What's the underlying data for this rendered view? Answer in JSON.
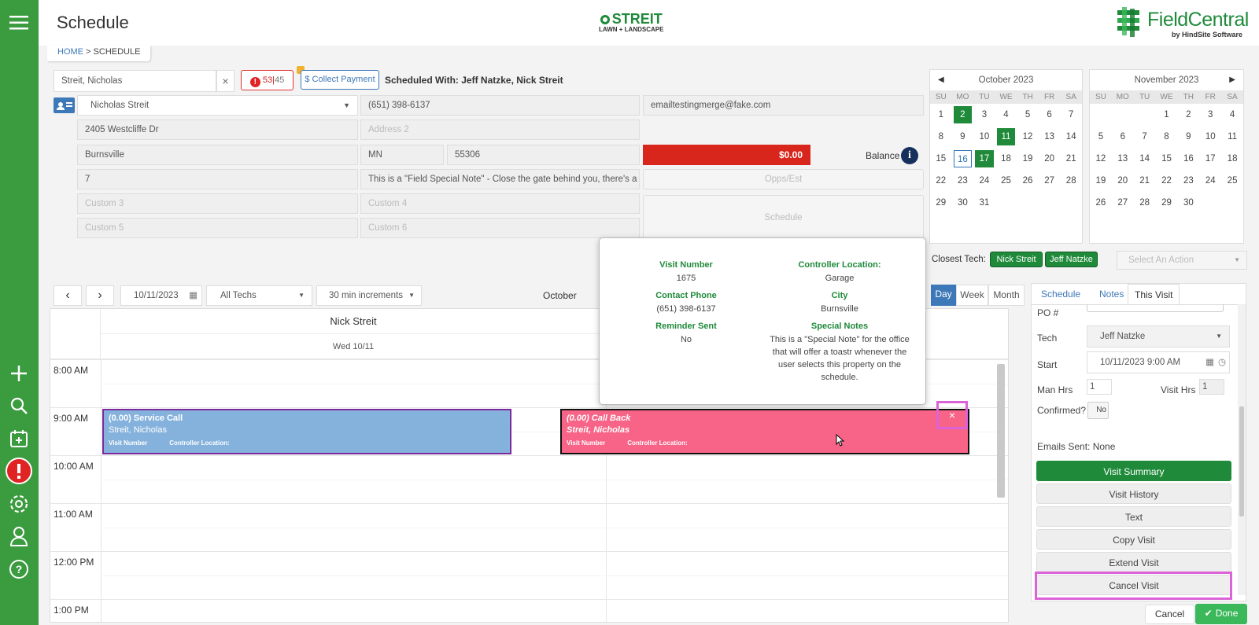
{
  "header": {
    "title": "Schedule",
    "brand_main": "STREIT",
    "brand_sub": "LAWN + LANDSCAPE",
    "logo_main": "FieldCentral",
    "logo_sub": "by HindSite Software"
  },
  "breadcrumb": {
    "home": "HOME",
    "sep": " > ",
    "current": "SCHEDULE"
  },
  "customer": {
    "search_value": "Streit, Nicholas",
    "alerts": "53",
    "alerts2": "45",
    "collect_payment": "$ Collect Payment",
    "scheduled_with": "Scheduled With: Jeff Natzke, Nick Streit",
    "name": "Nicholas Streit",
    "phone": "(651) 398-6137",
    "email": "emailtestingmerge@fake.com",
    "address1": "2405 Westcliffe Dr",
    "address2_placeholder": "Address 2",
    "city": "Burnsville",
    "state": "MN",
    "zip": "55306",
    "balance_amount": "$0.00",
    "balance_label": "Balance",
    "field7": "7",
    "special_note": "This is a \"Field Special Note\" - Close the gate behind you, there's a do",
    "opps_btn": "Opps/Est",
    "schedule_btn": "Schedule",
    "custom3": "Custom 3",
    "custom4": "Custom 4",
    "custom5": "Custom 5",
    "custom6": "Custom 6"
  },
  "calendars": [
    {
      "title": "October 2023",
      "dow": [
        "SU",
        "MO",
        "TU",
        "WE",
        "TH",
        "FR",
        "SA"
      ],
      "days": [
        "1",
        "2",
        "3",
        "4",
        "5",
        "6",
        "7",
        "8",
        "9",
        "10",
        "11",
        "12",
        "13",
        "14",
        "15",
        "16",
        "17",
        "18",
        "19",
        "20",
        "21",
        "22",
        "23",
        "24",
        "25",
        "26",
        "27",
        "28",
        "29",
        "30",
        "31"
      ],
      "lead": 0
    },
    {
      "title": "November 2023",
      "dow": [
        "SU",
        "MO",
        "TU",
        "WE",
        "TH",
        "FR",
        "SA"
      ],
      "days": [
        "1",
        "2",
        "3",
        "4",
        "5",
        "6",
        "7",
        "8",
        "9",
        "10",
        "11",
        "12",
        "13",
        "14",
        "15",
        "16",
        "17",
        "18",
        "19",
        "20",
        "21",
        "22",
        "23",
        "24",
        "25",
        "26",
        "27",
        "28",
        "29",
        "30"
      ],
      "lead": 3
    }
  ],
  "closest": {
    "label": "Closest Tech:",
    "tech1": "Nick Streit",
    "tech2": "Jeff Natzke",
    "action_placeholder": "Select An Action"
  },
  "toolbar": {
    "date": "10/11/2023",
    "techs": "All Techs",
    "increments": "30 min increments",
    "month": "October",
    "views": [
      "Day",
      "Week",
      "Month"
    ]
  },
  "popup": {
    "visit_number_label": "Visit Number",
    "visit_number": "1675",
    "contact_phone_label": "Contact Phone",
    "contact_phone": "(651) 398-6137",
    "reminder_label": "Reminder Sent",
    "reminder": "No",
    "controller_label": "Controller Location:",
    "controller": "Garage",
    "city_label": "City",
    "city": "Burnsville",
    "notes_label": "Special Notes",
    "notes": "This is a \"Special Note\" for the office that will offer a toastr whenever the user selects this property on the schedule."
  },
  "schedule": {
    "tech_header": "Nick Streit",
    "date_header": "Wed 10/11",
    "times": [
      "8:00 AM",
      "9:00 AM",
      "10:00 AM",
      "11:00 AM",
      "12:00 PM",
      "1:00 PM"
    ],
    "event1": {
      "title": "(0.00) Service Call",
      "customer": "Streit, Nicholas",
      "f1": "Visit Number",
      "f2": "Controller Location:"
    },
    "event2": {
      "title": "(0.00) Call Back",
      "customer": "Streit, Nicholas",
      "f1": "Visit Number",
      "f2": "Controller Location:"
    },
    "close_glyph": "×"
  },
  "panel": {
    "tabs": [
      "Schedule",
      "Notes",
      "This Visit"
    ],
    "po_label": "PO #",
    "tech_label": "Tech",
    "tech_value": "Jeff Natzke",
    "start_label": "Start",
    "start_value": "10/11/2023 9:00 AM",
    "manhrs_label": "Man Hrs",
    "manhrs": "1",
    "visithrs_label": "Visit Hrs",
    "visithrs": "1",
    "confirmed_label": "Confirmed?",
    "confirmed": "No",
    "emails": "Emails Sent: None",
    "buttons": [
      "Visit Summary",
      "Visit History",
      "Text",
      "Copy Visit",
      "Extend Visit",
      "Cancel Visit"
    ],
    "cancel": "Cancel",
    "done": "Done"
  },
  "colors": {
    "green": "#1f8a3a",
    "sidebar": "#3b9b3f",
    "balance": "#d9261c",
    "event_blue": "#85b2dc",
    "event_pink": "#f76487",
    "highlight": "#dc62d8"
  }
}
